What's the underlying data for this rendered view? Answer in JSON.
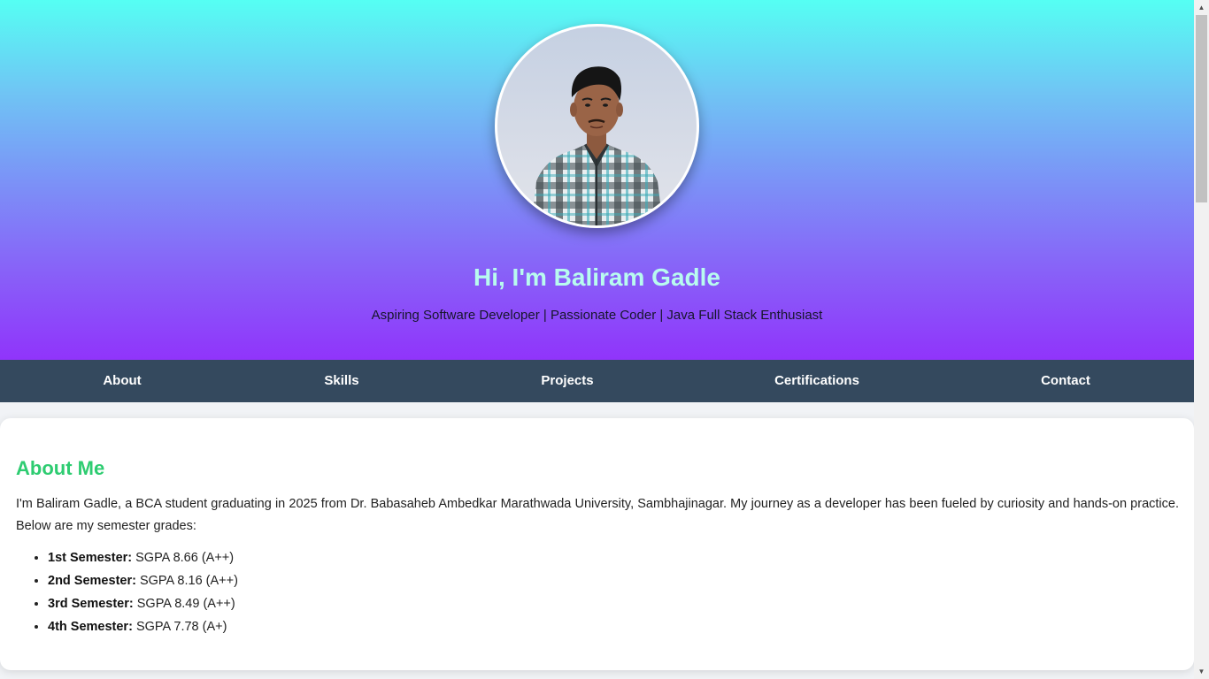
{
  "hero": {
    "avatar_alt": "Profile photo of Baliram Gadle",
    "title": "Hi, I'm Baliram Gadle",
    "subtitle": "Aspiring Software Developer | Passionate Coder | Java Full Stack Enthusiast"
  },
  "nav": {
    "items": [
      {
        "label": "About"
      },
      {
        "label": "Skills"
      },
      {
        "label": "Projects"
      },
      {
        "label": "Certifications"
      },
      {
        "label": "Contact"
      }
    ]
  },
  "about": {
    "heading": "About Me",
    "intro": "I'm Baliram Gadle, a BCA student graduating in 2025 from Dr. Babasaheb Ambedkar Marathwada University, Sambhajinagar. My journey as a developer has been fueled by curiosity and hands-on practice. Below are my semester grades:",
    "grades": [
      {
        "semester": "1st Semester:",
        "value": "SGPA 8.66 (A++)"
      },
      {
        "semester": "2nd Semester:",
        "value": "SGPA 8.16 (A++)"
      },
      {
        "semester": "3rd Semester:",
        "value": "SGPA 8.49 (A++)"
      },
      {
        "semester": "4th Semester:",
        "value": "SGPA 7.78 (A+)"
      }
    ]
  },
  "colors": {
    "hero_gradient_top": "#55fff3",
    "hero_gradient_bottom": "#9034fb",
    "title_color": "#b8fbef",
    "nav_bg": "#34495e",
    "section_heading": "#2ecc71"
  },
  "icons": {
    "scroll_up": "scroll-up-arrow-icon",
    "scroll_down": "scroll-down-arrow-icon"
  }
}
